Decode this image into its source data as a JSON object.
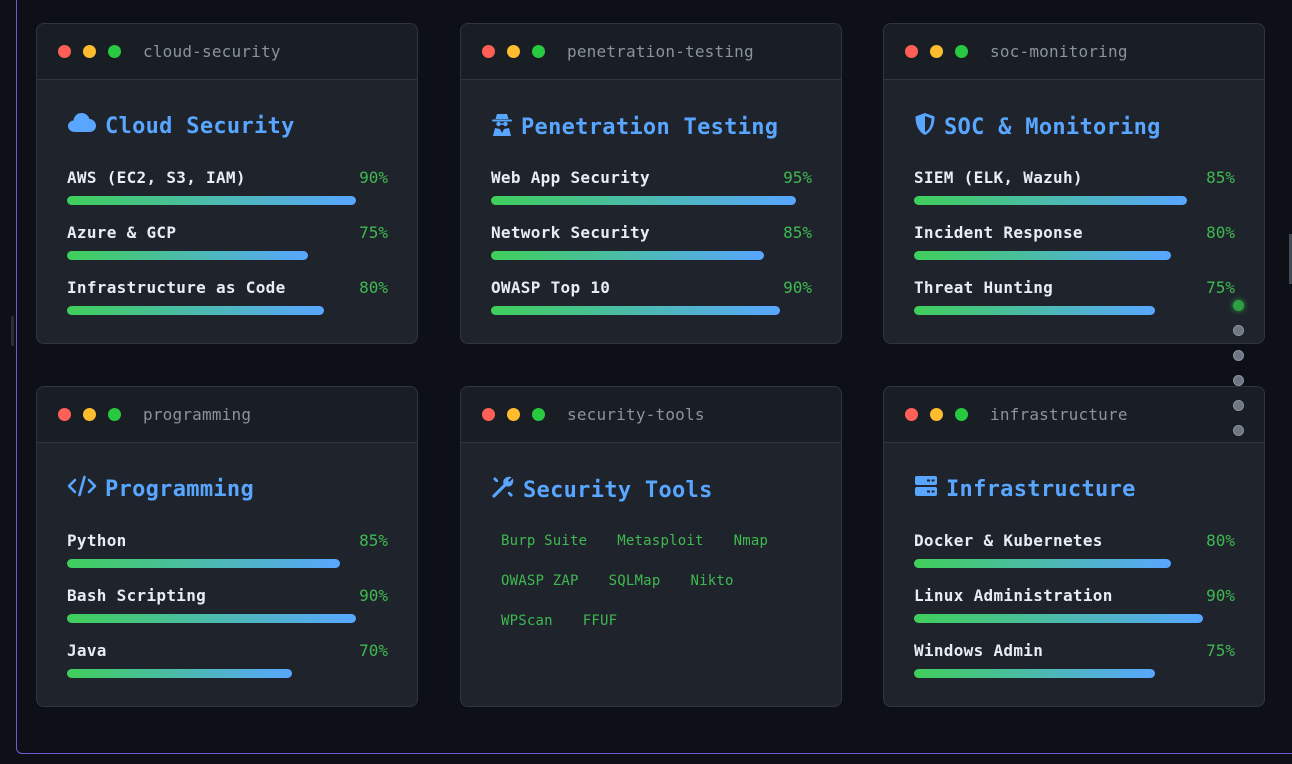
{
  "cards": [
    {
      "window_title": "cloud-security",
      "heading": "Cloud Security",
      "icon": "cloud-icon",
      "skills": [
        {
          "name": "AWS (EC2, S3, IAM)",
          "percent_label": "90%",
          "value": 90
        },
        {
          "name": "Azure & GCP",
          "percent_label": "75%",
          "value": 75
        },
        {
          "name": "Infrastructure as Code",
          "percent_label": "80%",
          "value": 80
        }
      ]
    },
    {
      "window_title": "penetration-testing",
      "heading": "Penetration Testing",
      "icon": "user-secret-icon",
      "skills": [
        {
          "name": "Web App Security",
          "percent_label": "95%",
          "value": 95
        },
        {
          "name": "Network Security",
          "percent_label": "85%",
          "value": 85
        },
        {
          "name": "OWASP Top 10",
          "percent_label": "90%",
          "value": 90
        }
      ]
    },
    {
      "window_title": "soc-monitoring",
      "heading": "SOC & Monitoring",
      "icon": "shield-icon",
      "skills": [
        {
          "name": "SIEM (ELK, Wazuh)",
          "percent_label": "85%",
          "value": 85
        },
        {
          "name": "Incident Response",
          "percent_label": "80%",
          "value": 80
        },
        {
          "name": "Threat Hunting",
          "percent_label": "75%",
          "value": 75
        }
      ]
    },
    {
      "window_title": "programming",
      "heading": "Programming",
      "icon": "code-icon",
      "skills": [
        {
          "name": "Python",
          "percent_label": "85%",
          "value": 85
        },
        {
          "name": "Bash Scripting",
          "percent_label": "90%",
          "value": 90
        },
        {
          "name": "Java",
          "percent_label": "70%",
          "value": 70
        }
      ]
    },
    {
      "window_title": "security-tools",
      "heading": "Security Tools",
      "icon": "tools-icon",
      "tags": [
        "Burp Suite",
        "Metasploit",
        "Nmap",
        "OWASP ZAP",
        "SQLMap",
        "Nikto",
        "WPScan",
        "FFUF"
      ]
    },
    {
      "window_title": "infrastructure",
      "heading": "Infrastructure",
      "icon": "server-icon",
      "skills": [
        {
          "name": "Docker & Kubernetes",
          "percent_label": "80%",
          "value": 80
        },
        {
          "name": "Linux Administration",
          "percent_label": "90%",
          "value": 90
        },
        {
          "name": "Windows Admin",
          "percent_label": "75%",
          "value": 75
        }
      ]
    }
  ],
  "nav_dots": {
    "count": 6,
    "active_index": 0
  },
  "colors": {
    "accent_blue": "#58a6ff",
    "accent_green": "#3fb950",
    "card_bg": "#1f242c",
    "page_bg": "#0d1117"
  }
}
